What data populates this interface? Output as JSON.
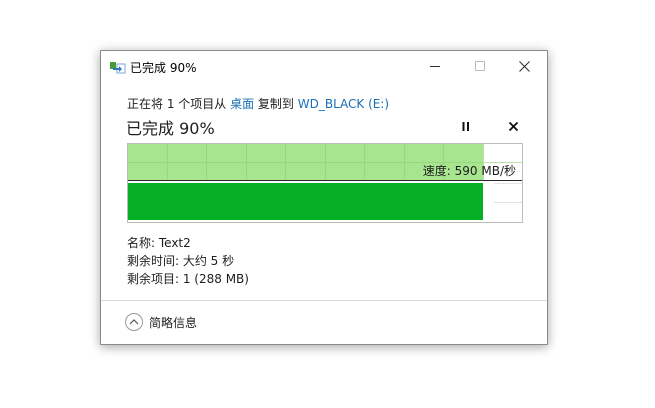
{
  "window": {
    "title": "已完成 90%",
    "controls": {
      "minimize": "minimize-icon",
      "maximize": "maximize-icon",
      "close": "close-icon"
    }
  },
  "transfer": {
    "prefix": "正在将 1 个项目从 ",
    "source": "桌面",
    "middle": " 复制到 ",
    "destination": "WD_BLACK (E:)",
    "status": "已完成 90%",
    "progress_percent": 90,
    "speed_label": "速度: 590 MB/秒"
  },
  "details": {
    "name": "名称: Text2",
    "time_remaining": "剩余时间: 大约 5 秒",
    "items_remaining": "剩余项目: 1 (288 MB)"
  },
  "footer": {
    "toggle_label": "简略信息"
  },
  "colors": {
    "progress": "#06b025",
    "speed_area": "#a8e58f",
    "link": "#1a6fb5"
  }
}
